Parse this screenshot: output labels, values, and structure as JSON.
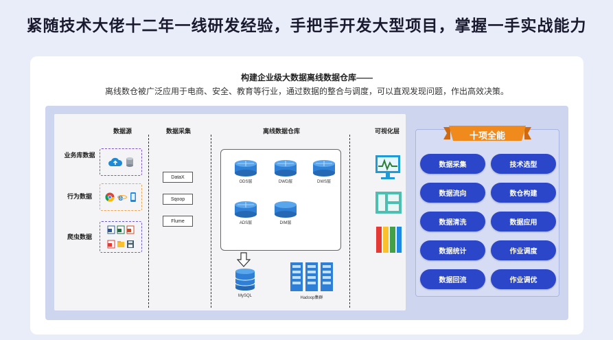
{
  "headline": "紧随技术大佬十二年一线研发经验，手把手开发大型项目，掌握一手实战能力",
  "card": {
    "title": "构建企业级大数据离线数据仓库——",
    "subtitle": "离线数仓被广泛应用于电商、安全、教育等行业，通过数据的整合与调度，可以直观发现问题，作出高效决策。"
  },
  "diagram": {
    "columns": {
      "sources": "数据源",
      "collection": "数据采集",
      "warehouse": "离线数据仓库",
      "visual": "可视化层"
    },
    "sources": [
      {
        "label": "业务库数据",
        "color": "#7b52c7"
      },
      {
        "label": "行为数据",
        "color": "#f0a24a"
      },
      {
        "label": "爬虫数据",
        "color": "#6a5bd0"
      }
    ],
    "tools": [
      "DataX",
      "Sqoop",
      "Flume"
    ],
    "layers": [
      "ODS层",
      "DWD层",
      "DWS层",
      "ADS层",
      "DIM层"
    ],
    "storage": {
      "mysql": "MySQL",
      "hadoop": "Hadoop集群"
    }
  },
  "capabilities": {
    "title": "十项全能",
    "items": [
      "数据采集",
      "技术选型",
      "数据流向",
      "数仓构建",
      "数据清洗",
      "数据应用",
      "数据统计",
      "作业调度",
      "数据回流",
      "作业调优"
    ]
  },
  "colors": {
    "accent_orange": "#f08a1c",
    "pill_blue": "#2b46c9",
    "cylinder_blue": "#2f7fd6"
  }
}
